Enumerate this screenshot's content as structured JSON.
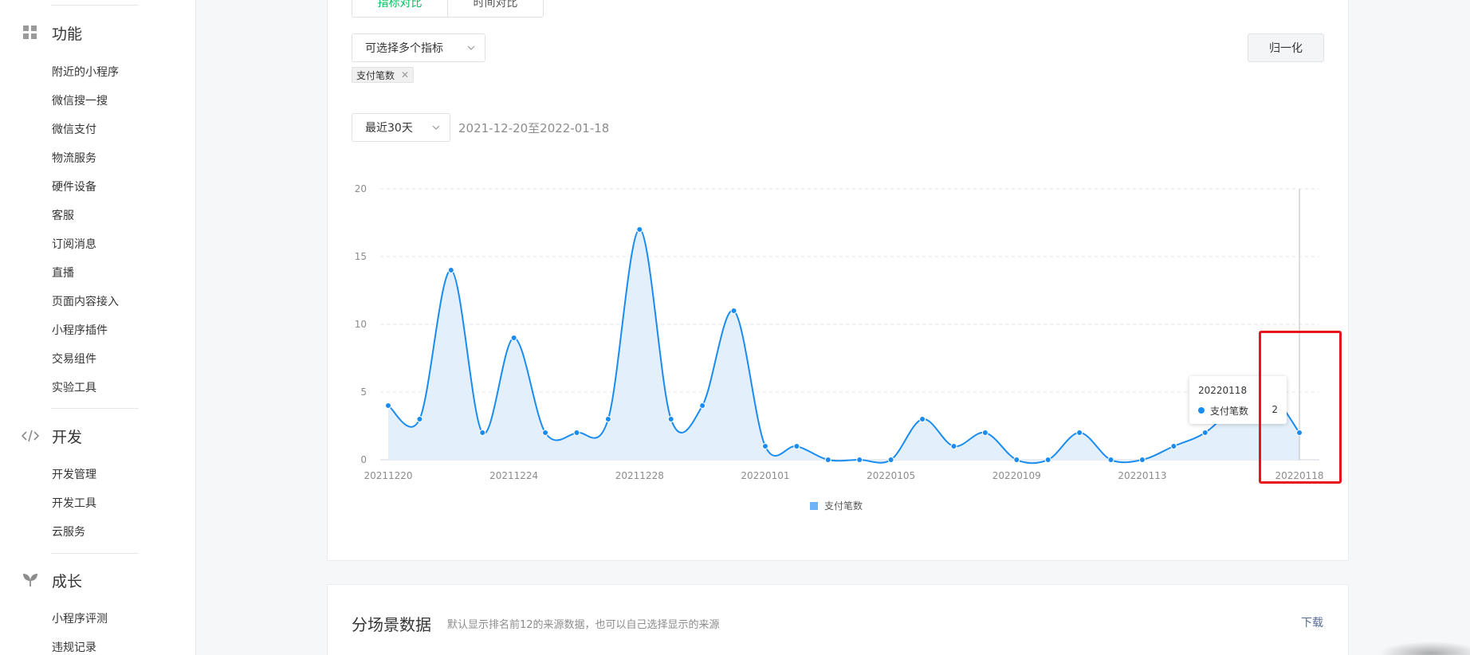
{
  "sidebar": {
    "sections": [
      {
        "title": "功能",
        "icon": "grid-icon",
        "items": [
          "附近的小程序",
          "微信搜一搜",
          "微信支付",
          "物流服务",
          "硬件设备",
          "客服",
          "订阅消息",
          "直播",
          "页面内容接入",
          "小程序插件",
          "交易组件",
          "实验工具"
        ]
      },
      {
        "title": "开发",
        "icon": "code-icon",
        "items": [
          "开发管理",
          "开发工具",
          "云服务"
        ]
      },
      {
        "title": "成长",
        "icon": "sprout-icon",
        "items": [
          "小程序评测",
          "违规记录"
        ]
      }
    ]
  },
  "main": {
    "segment": {
      "active_label": "指标对比",
      "inactive_label": "时间对比"
    },
    "metric_select": {
      "placeholder": "可选择多个指标"
    },
    "selected_tag": "支付笔数",
    "normalize_button": "归一化",
    "range_select": {
      "value": "最近30天"
    },
    "date_range": "2021-12-20至2022-01-18",
    "tooltip": {
      "date": "20220118",
      "series": "支付笔数",
      "value": "2"
    },
    "legend": "支付笔数"
  },
  "chart_data": {
    "type": "area",
    "x": [
      "20211220",
      "20211221",
      "20211222",
      "20211223",
      "20211224",
      "20211225",
      "20211226",
      "20211227",
      "20211228",
      "20211229",
      "20211230",
      "20211231",
      "20220101",
      "20220102",
      "20220103",
      "20220104",
      "20220105",
      "20220106",
      "20220107",
      "20220108",
      "20220109",
      "20220110",
      "20220111",
      "20220112",
      "20220113",
      "20220114",
      "20220115",
      "20220116",
      "20220117",
      "20220118"
    ],
    "x_tick_labels": [
      "20211220",
      "20211224",
      "20211228",
      "20220101",
      "20220105",
      "20220109",
      "20220113",
      "20220118"
    ],
    "series": [
      {
        "name": "支付笔数",
        "values": [
          4,
          3,
          14,
          2,
          9,
          2,
          2,
          3,
          17,
          3,
          4,
          11,
          1,
          1,
          0,
          0,
          0,
          3,
          1,
          2,
          0,
          0,
          2,
          0,
          0,
          1,
          2,
          4,
          5,
          2
        ],
        "color": "#1a8cf0"
      }
    ],
    "ylim": [
      0,
      20
    ],
    "y_ticks": [
      0,
      5,
      10,
      15,
      20
    ],
    "grid": "horizontal dashed",
    "legend_position": "bottom-center"
  },
  "bottom_card": {
    "title": "分场景数据",
    "description": "默认显示排名前12的来源数据，也可以自己选择显示的来源",
    "download": "下载"
  }
}
